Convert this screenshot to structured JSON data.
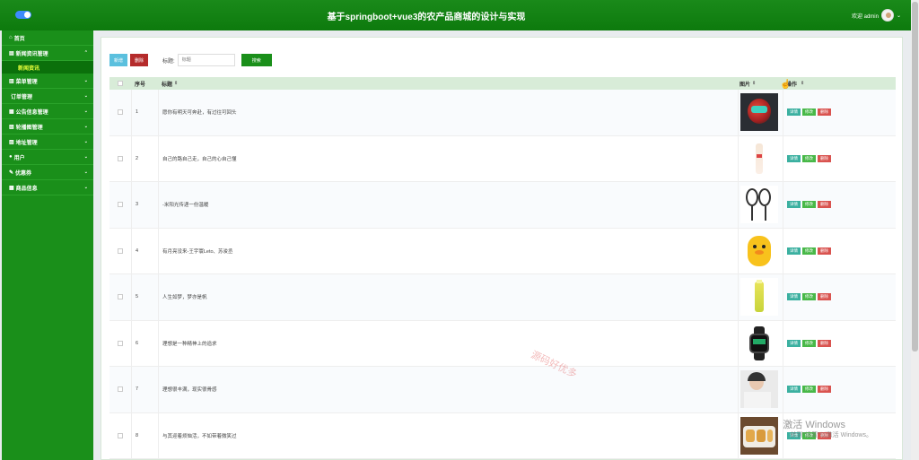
{
  "header": {
    "title": "基于springboot+vue3的农产品商城的设计与实现",
    "welcome": "欢迎 admin"
  },
  "sidebar": {
    "items": [
      {
        "label": "首页",
        "icon": "home-icon",
        "chevron": ""
      },
      {
        "label": "新闻资讯管理",
        "icon": "news-icon",
        "chevron": "⌃"
      },
      {
        "label": "新闻资讯",
        "sub": true
      },
      {
        "label": "菜单管理",
        "icon": "menu-icon",
        "chevron": "⌄"
      },
      {
        "label": "订单管理",
        "icon": "order-icon",
        "chevron": "⌄"
      },
      {
        "label": "公告信息管理",
        "icon": "notice-icon",
        "chevron": "⌄"
      },
      {
        "label": "轮播图管理",
        "icon": "carousel-icon",
        "chevron": "⌄"
      },
      {
        "label": "地址管理",
        "icon": "address-icon",
        "chevron": "⌄"
      },
      {
        "label": "用户",
        "icon": "user-icon",
        "chevron": "⌄"
      },
      {
        "label": "优惠券",
        "icon": "coupon-icon",
        "chevron": "⌄"
      },
      {
        "label": "商品信息",
        "icon": "goods-icon",
        "chevron": "⌄"
      }
    ]
  },
  "toolbar": {
    "add_label": "新增",
    "delete_label": "删除",
    "search_label": "标题:",
    "search_placeholder": "标题",
    "search_button": "搜索"
  },
  "table": {
    "headers": {
      "index": "序号",
      "title": "标题",
      "image": "图片",
      "ops": "操作"
    },
    "ops_labels": {
      "detail": "详情",
      "edit": "修改",
      "delete": "删除"
    },
    "rows": [
      {
        "index": "1",
        "title": "愿你有明天可奔赴，有过往可回头",
        "image": "helmet-photo"
      },
      {
        "index": "2",
        "title": "自己的路自己走，自己的心自己懂",
        "image": "bottle-photo"
      },
      {
        "index": "3",
        "title": "-米阳光传递一份温暖",
        "image": "racket-photo"
      },
      {
        "index": "4",
        "title": "有月亮没来-王宇寰Leto、苏浚丞",
        "image": "backpack-photo"
      },
      {
        "index": "5",
        "title": "人生如梦，梦亦是帆",
        "image": "drink-photo"
      },
      {
        "index": "6",
        "title": "理想是一种精神上的追求",
        "image": "watch-photo"
      },
      {
        "index": "7",
        "title": "理想很丰满，现实很骨感",
        "image": "portrait-photo"
      },
      {
        "index": "8",
        "title": "与其迎着烦恼活，不如带着微笑过",
        "image": "food-photo"
      }
    ]
  },
  "watermark": "源码好优多",
  "windows_notice": {
    "line1": "激活 Windows",
    "line2": "转到\"设置\"以激活 Windows。"
  },
  "colors": {
    "brand_green": "#1a8f1a",
    "header_bg": "#d8ecd8"
  }
}
